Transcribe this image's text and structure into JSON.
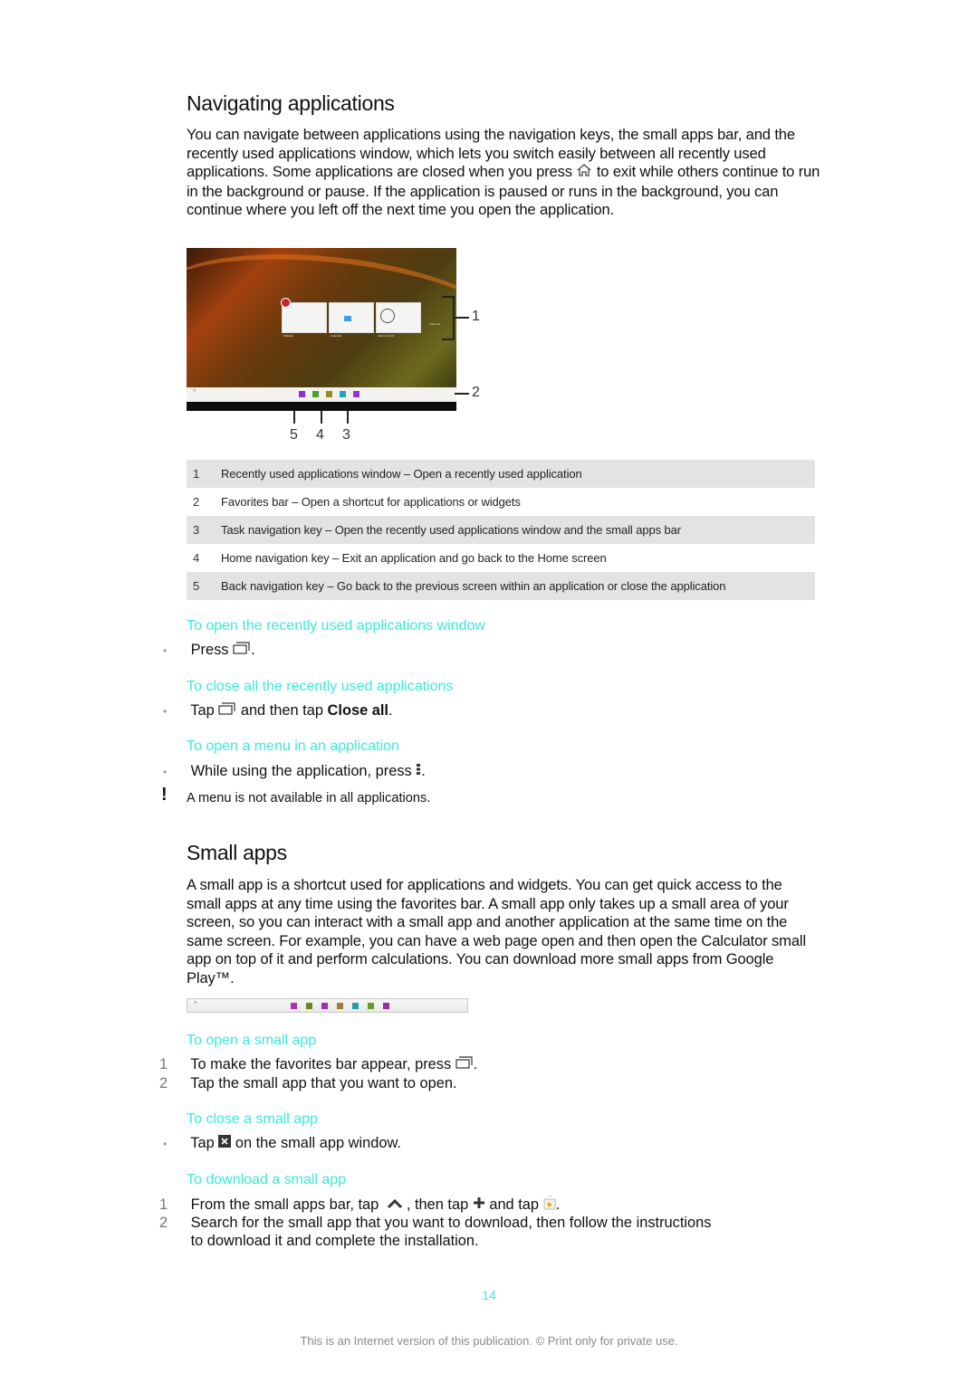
{
  "section1": {
    "title": "Navigating applications",
    "intro": "You can navigate between applications using the navigation keys, the small apps bar, and the recently used applications window, which lets you switch easily between all recently used applications. Some applications are closed when you press",
    "intro_icon": "home-icon",
    "intro_rest": "to exit while others continue to run in the background or pause. If the application is paused or runs in the background, you can continue where you left off the next time you open the application.",
    "figure": {
      "thumbnails": [
        "Settings",
        "Calendar",
        "Alarm & clock"
      ],
      "close_all": "Close all",
      "callouts": [
        "1",
        "2",
        "5",
        "4",
        "3"
      ],
      "favorite_icon_colors": [
        "#8a2fd0",
        "#4aa02a",
        "#9a8a20",
        "#2aa0c0",
        "#9a30d0"
      ]
    },
    "legend": [
      {
        "num": "1",
        "text": "Recently used applications window – Open a recently used application"
      },
      {
        "num": "2",
        "text": "Favorites bar – Open a shortcut for applications or widgets"
      },
      {
        "num": "3",
        "text": "Task navigation key – Open the recently used applications window and the small apps bar"
      },
      {
        "num": "4",
        "text": "Home navigation key – Exit an application and go back to the Home screen"
      },
      {
        "num": "5",
        "text": "Back navigation key – Go back to the previous screen within an application or close the application"
      }
    ],
    "open_recent": {
      "heading": "To open the recently used applications window",
      "bullet_prefix": "Press",
      "bullet_icon": "recent-apps-icon",
      "bullet_suffix": "."
    },
    "close_recent": {
      "heading": "To close all the recently used applications",
      "bullet_prefix": "Tap",
      "bullet_icon": "recent-apps-icon",
      "bullet_middle": "and then tap",
      "bullet_bold": "Close all",
      "bullet_suffix": "."
    },
    "open_menu": {
      "heading": "To open a menu in an application",
      "bullet_prefix": "While using the application, press",
      "bullet_icon": "menu-icon",
      "bullet_suffix": ".",
      "note_icon": "exclamation-icon",
      "note": "A menu is not available in all applications."
    }
  },
  "section2": {
    "title": "Small apps",
    "intro": "A small app is a shortcut used for applications and widgets. You can get quick access to the small apps at any time using the favorites bar. A small app only takes up a small area of your screen, so you can interact with a small app and another application at the same time on the same screen. For example, you can have a web page open and then open the Calculator small app on top of it and perform calculations. You can download more small apps from Google Play™.",
    "bar_icon_colors": [
      "#b030b0",
      "#6a8a20",
      "#a030b0",
      "#9a8030",
      "#2a9ab0",
      "#6a9a20",
      "#9a30a0"
    ],
    "open_small": {
      "heading": "To open a small app",
      "steps": [
        {
          "num": "1",
          "prefix": "To make the favorites bar appear, press",
          "icon": "recent-apps-icon",
          "suffix": "."
        },
        {
          "num": "2",
          "text": "Tap the small app that you want to open."
        }
      ]
    },
    "close_small": {
      "heading": "To close a small app",
      "bullet_prefix": "Tap",
      "bullet_icon": "close-box-icon",
      "bullet_suffix": "on the small app window."
    },
    "download_small": {
      "heading": "To download a small app",
      "steps": [
        {
          "num": "1",
          "p1": "From the small apps bar, tap",
          "i1": "chevron-up-icon",
          "p2": ", then tap",
          "i2": "plus-icon",
          "p3": "and tap",
          "i3": "play-store-icon",
          "p4": "."
        },
        {
          "num": "2",
          "line1": "Search for the small app that you want to download, then follow the instructions",
          "line2": "to download it and complete the installation."
        }
      ]
    }
  },
  "page_number": "14",
  "footer": "This is an Internet version of this publication. © Print only for private use.",
  "colors": {
    "accent": "#3ee9d8",
    "text": "#111111",
    "legend_shade": "#e3e3e3"
  }
}
